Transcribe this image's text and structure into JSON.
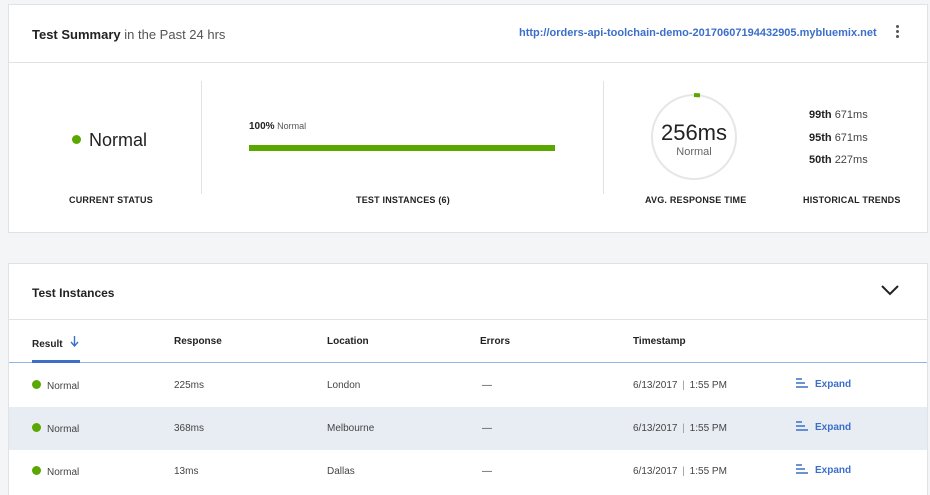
{
  "summary": {
    "title": "Test Summary",
    "subtitle": "in the Past 24 hrs",
    "url": "http://orders-api-toolchain-demo-20170607194432905.mybluemix.net",
    "current_status": "Normal",
    "current_status_label": "CURRENT STATUS",
    "instances_percent": "100%",
    "instances_percent_state": "Normal",
    "instances_fill": 1.0,
    "instances_label": "TEST INSTANCES (6)",
    "avg_response_value": "256ms",
    "avg_response_state": "Normal",
    "avg_response_label": "AVG. RESPONSE TIME",
    "trends": [
      {
        "percentile": "99th",
        "value": "671ms"
      },
      {
        "percentile": "95th",
        "value": "671ms"
      },
      {
        "percentile": "50th",
        "value": "227ms"
      }
    ],
    "trends_label": "HISTORICAL TRENDS",
    "colors": {
      "normal": "#5aa700",
      "link": "#3b6fc9"
    }
  },
  "instances": {
    "title": "Test Instances",
    "columns": {
      "result": "Result",
      "response": "Response",
      "location": "Location",
      "errors": "Errors",
      "timestamp": "Timestamp"
    },
    "expand_label": "Expand",
    "rows": [
      {
        "result": "Normal",
        "response": "225ms",
        "location": "London",
        "errors": "—",
        "date": "6/13/2017",
        "time": "1:55 PM"
      },
      {
        "result": "Normal",
        "response": "368ms",
        "location": "Melbourne",
        "errors": "—",
        "date": "6/13/2017",
        "time": "1:55 PM"
      },
      {
        "result": "Normal",
        "response": "13ms",
        "location": "Dallas",
        "errors": "—",
        "date": "6/13/2017",
        "time": "1:55 PM"
      }
    ]
  }
}
